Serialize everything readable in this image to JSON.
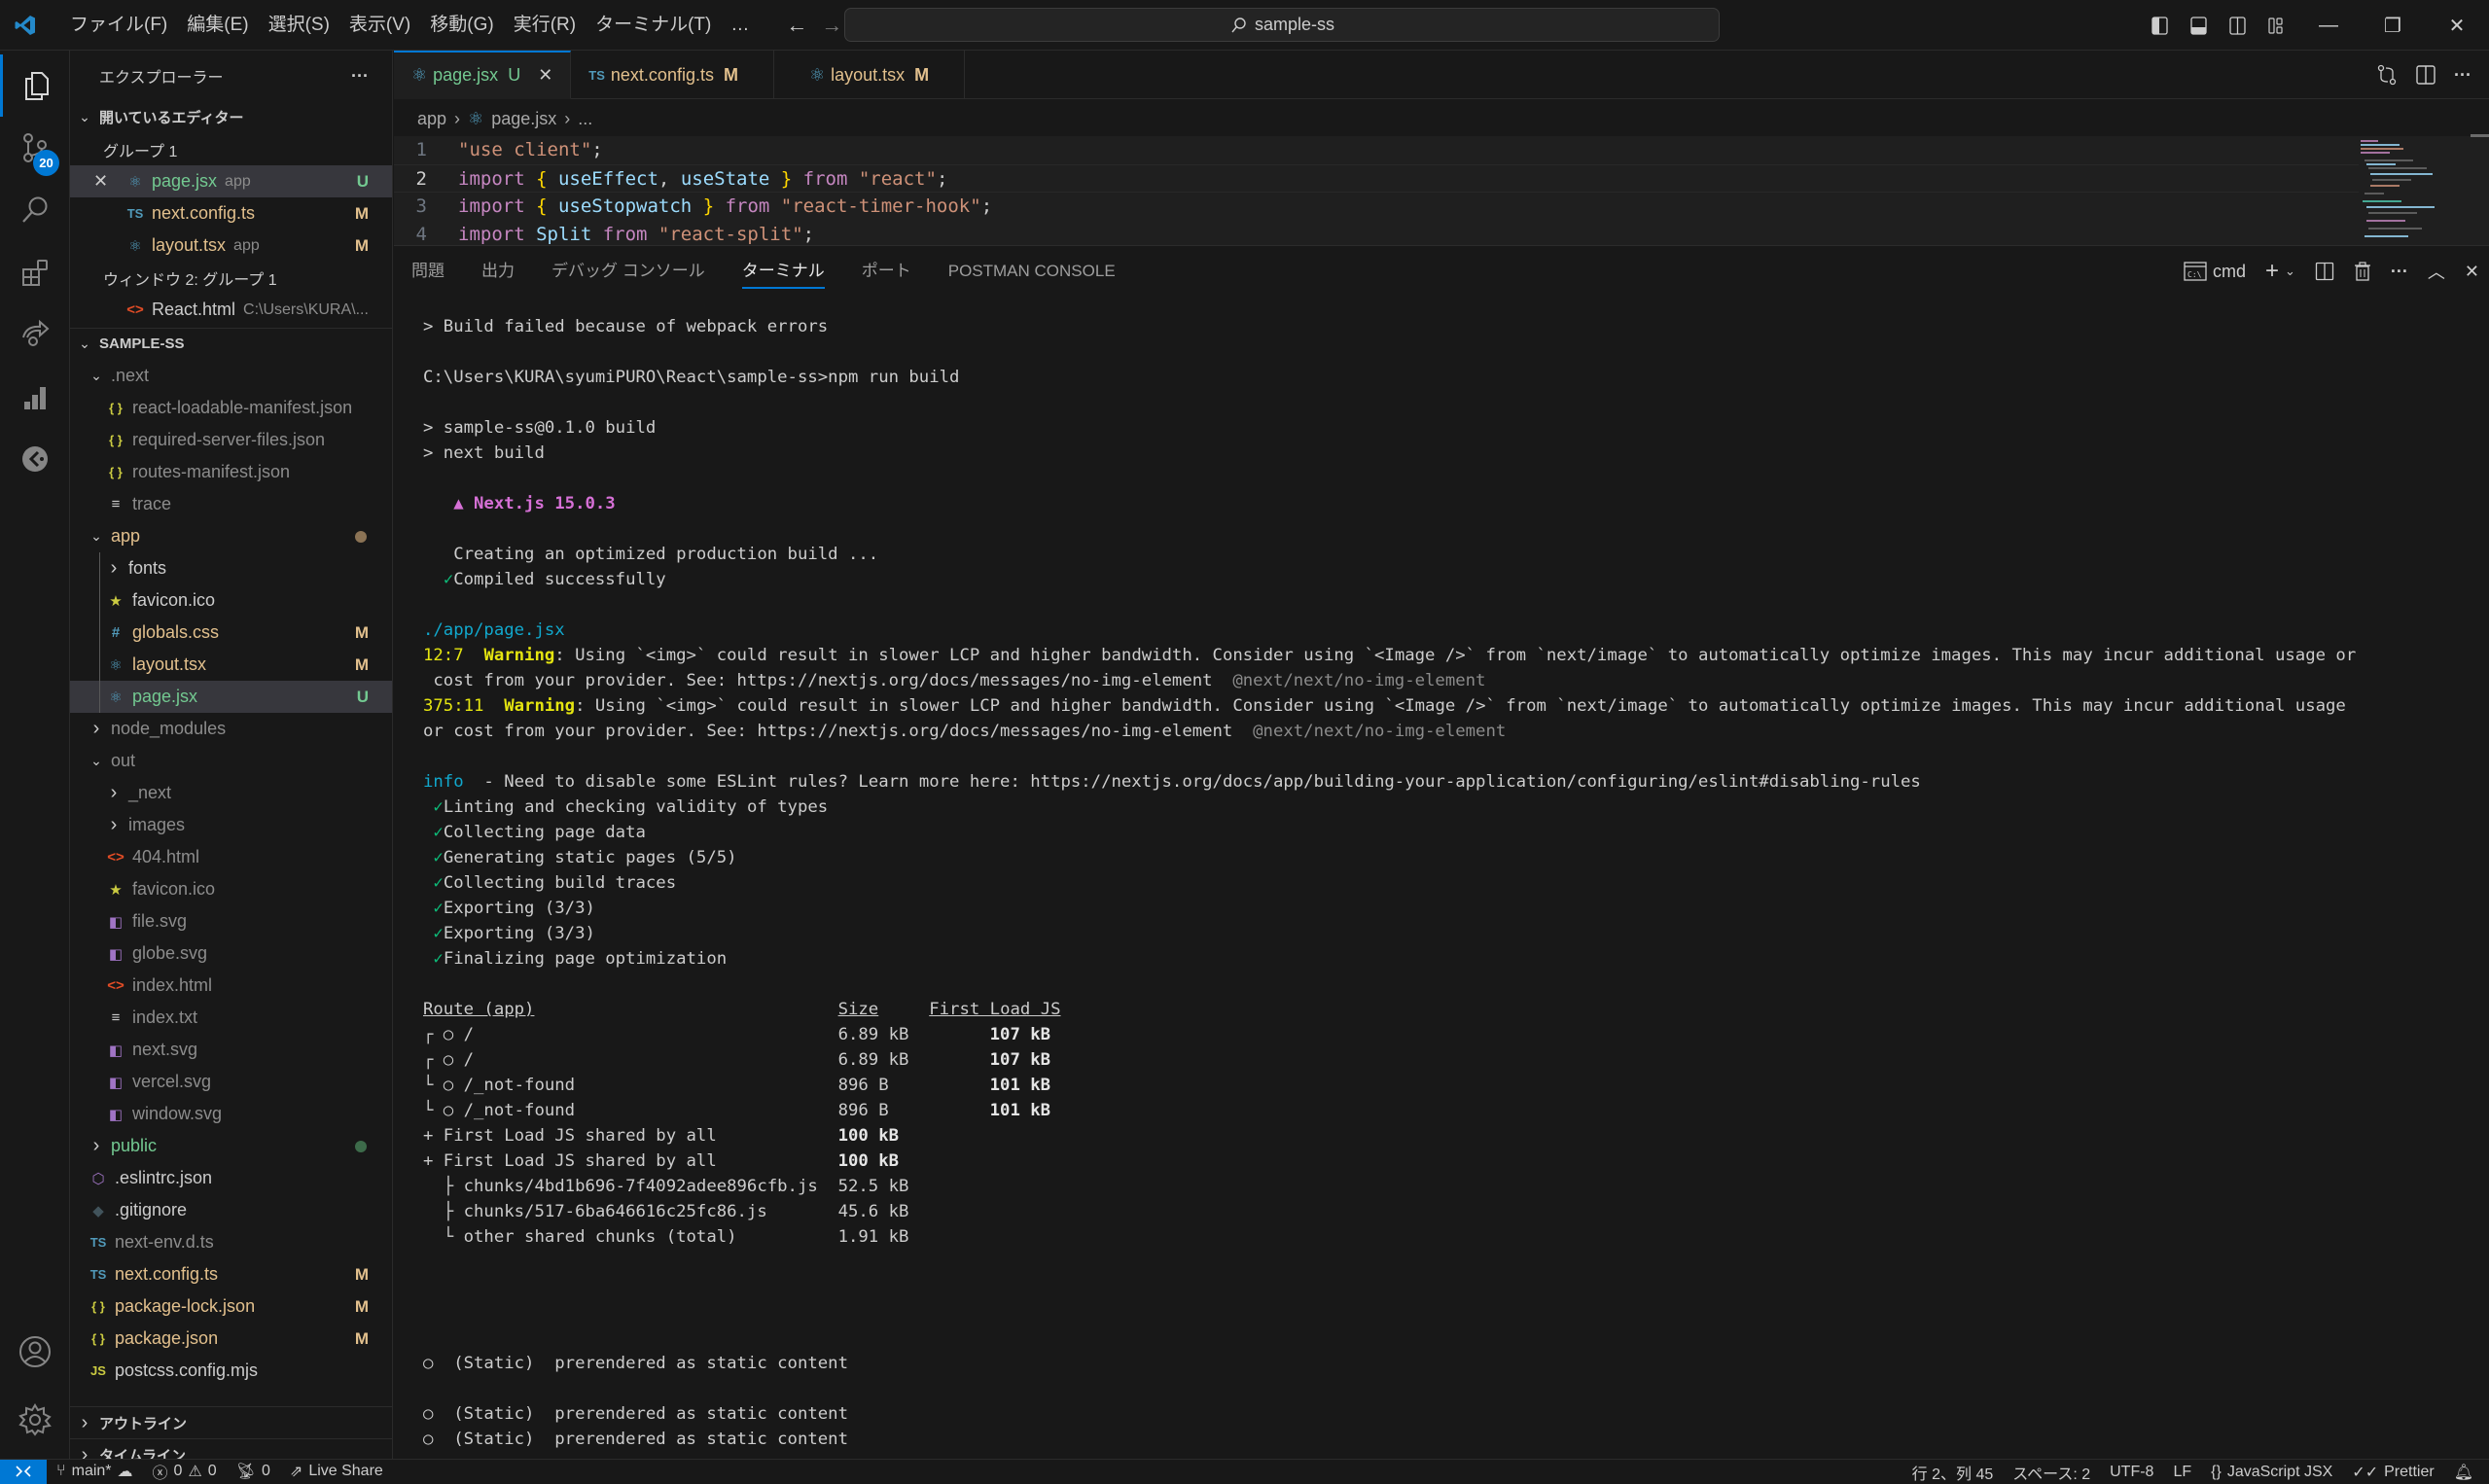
{
  "titlebar": {
    "menu": [
      "ファイル(F)",
      "編集(E)",
      "選択(S)",
      "表示(V)",
      "移動(G)",
      "実行(R)",
      "ターミナル(T)",
      "…"
    ],
    "search_text": "sample-ss",
    "icons": [
      "vscode-logo-icon",
      "back-arrow-icon",
      "forward-arrow-icon",
      "toggle-primary-sidebar-icon",
      "toggle-panel-icon",
      "toggle-secondary-sidebar-icon",
      "customize-layout-icon",
      "minimize-icon",
      "restore-icon",
      "close-icon"
    ]
  },
  "activitybar": {
    "items": [
      {
        "name": "explorer",
        "active": true
      },
      {
        "name": "source-control",
        "badge": "20"
      },
      {
        "name": "search"
      },
      {
        "name": "extensions"
      },
      {
        "name": "live-share"
      },
      {
        "name": "charts"
      },
      {
        "name": "gitlens"
      }
    ],
    "bottom": [
      "accounts",
      "manage"
    ]
  },
  "sidebar": {
    "title": "エクスプローラー",
    "more": "···",
    "open_editors": {
      "header": "開いているエディター",
      "group1": "グループ 1",
      "files": [
        {
          "name": "page.jsx",
          "desc": "app",
          "deco": "U",
          "icon": "react",
          "state": "untracked",
          "selected": true
        },
        {
          "name": "next.config.ts",
          "desc": "",
          "deco": "M",
          "icon": "ts",
          "state": "modified"
        },
        {
          "name": "layout.tsx",
          "desc": "app",
          "deco": "M",
          "icon": "react",
          "state": "modified"
        }
      ],
      "group2": "ウィンドウ 2: グループ 1",
      "files2": [
        {
          "name": "React.html",
          "desc": "C:\\Users\\KURA\\...",
          "icon": "html"
        }
      ]
    },
    "project": {
      "header": "SAMPLE-SS",
      "tree": [
        {
          "name": ".next",
          "type": "folder",
          "open": true,
          "depth": 1,
          "state": "ignored"
        },
        {
          "name": "react-loadable-manifest.json",
          "type": "json",
          "depth": 2,
          "state": "ignored"
        },
        {
          "name": "required-server-files.json",
          "type": "json",
          "depth": 2,
          "state": "ignored"
        },
        {
          "name": "routes-manifest.json",
          "type": "json",
          "depth": 2,
          "state": "ignored"
        },
        {
          "name": "trace",
          "type": "text",
          "depth": 2,
          "state": "ignored"
        },
        {
          "name": "app",
          "type": "folder",
          "open": true,
          "depth": 1,
          "state": "modified",
          "dot": "#8b7355"
        },
        {
          "name": "fonts",
          "type": "folder",
          "open": false,
          "depth": 2,
          "state": "normal"
        },
        {
          "name": "favicon.ico",
          "type": "star",
          "depth": 2,
          "state": "normal"
        },
        {
          "name": "globals.css",
          "type": "css",
          "depth": 2,
          "state": "modified",
          "deco": "M"
        },
        {
          "name": "layout.tsx",
          "type": "react",
          "depth": 2,
          "state": "modified",
          "deco": "M"
        },
        {
          "name": "page.jsx",
          "type": "react",
          "depth": 2,
          "state": "untracked",
          "deco": "U",
          "selected": true
        },
        {
          "name": "node_modules",
          "type": "folder",
          "open": false,
          "depth": 1,
          "state": "ignored"
        },
        {
          "name": "out",
          "type": "folder",
          "open": true,
          "depth": 1,
          "state": "ignored"
        },
        {
          "name": "_next",
          "type": "folder",
          "open": false,
          "depth": 2,
          "state": "ignored"
        },
        {
          "name": "images",
          "type": "folder",
          "open": false,
          "depth": 2,
          "state": "ignored"
        },
        {
          "name": "404.html",
          "type": "html",
          "depth": 2,
          "state": "ignored"
        },
        {
          "name": "favicon.ico",
          "type": "star",
          "depth": 2,
          "state": "ignored"
        },
        {
          "name": "file.svg",
          "type": "svg",
          "depth": 2,
          "state": "ignored"
        },
        {
          "name": "globe.svg",
          "type": "svg",
          "depth": 2,
          "state": "ignored"
        },
        {
          "name": "index.html",
          "type": "html",
          "depth": 2,
          "state": "ignored"
        },
        {
          "name": "index.txt",
          "type": "text",
          "depth": 2,
          "state": "ignored"
        },
        {
          "name": "next.svg",
          "type": "svg",
          "depth": 2,
          "state": "ignored"
        },
        {
          "name": "vercel.svg",
          "type": "svg",
          "depth": 2,
          "state": "ignored"
        },
        {
          "name": "window.svg",
          "type": "svg",
          "depth": 2,
          "state": "ignored"
        },
        {
          "name": "public",
          "type": "folder",
          "open": false,
          "depth": 1,
          "state": "untracked",
          "dot": "#3d6b4a"
        },
        {
          "name": ".eslintrc.json",
          "type": "eslint",
          "depth": 1,
          "state": "normal"
        },
        {
          "name": ".gitignore",
          "type": "git",
          "depth": 1,
          "state": "normal"
        },
        {
          "name": "next-env.d.ts",
          "type": "ts",
          "depth": 1,
          "state": "ignored"
        },
        {
          "name": "next.config.ts",
          "type": "ts",
          "depth": 1,
          "state": "modified",
          "deco": "M"
        },
        {
          "name": "package-lock.json",
          "type": "json",
          "depth": 1,
          "state": "modified",
          "deco": "M"
        },
        {
          "name": "package.json",
          "type": "json",
          "depth": 1,
          "state": "modified",
          "deco": "M"
        },
        {
          "name": "postcss.config.mjs",
          "type": "js",
          "depth": 1,
          "state": "normal"
        }
      ]
    },
    "outline": "アウトライン",
    "timeline": "タイムライン"
  },
  "editor": {
    "tabs": [
      {
        "label": "page.jsx",
        "badge": "U",
        "icon": "react",
        "active": true
      },
      {
        "label": "next.config.ts",
        "badge": "M",
        "icon": "ts"
      },
      {
        "label": "layout.tsx",
        "badge": "M",
        "icon": "react"
      }
    ],
    "breadcrumb": [
      "app",
      "page.jsx",
      "..."
    ],
    "current_line": 2,
    "lines": [
      {
        "n": "1",
        "tokens": [
          {
            "t": "\"use client\"",
            "c": "str"
          },
          {
            "t": ";",
            "c": "pl"
          }
        ]
      },
      {
        "n": "2",
        "tokens": [
          {
            "t": "import ",
            "c": "kw"
          },
          {
            "t": "{ ",
            "c": "br"
          },
          {
            "t": "useEffect",
            "c": "var"
          },
          {
            "t": ", ",
            "c": "pl"
          },
          {
            "t": "useState",
            "c": "var"
          },
          {
            "t": " }",
            "c": "br"
          },
          {
            "t": " from ",
            "c": "kw"
          },
          {
            "t": "\"react\"",
            "c": "str"
          },
          {
            "t": ";",
            "c": "pl"
          }
        ]
      },
      {
        "n": "3",
        "tokens": [
          {
            "t": "import ",
            "c": "kw"
          },
          {
            "t": "{ ",
            "c": "br"
          },
          {
            "t": "useStopwatch",
            "c": "var"
          },
          {
            "t": " }",
            "c": "br"
          },
          {
            "t": " from ",
            "c": "kw"
          },
          {
            "t": "\"react-timer-hook\"",
            "c": "str"
          },
          {
            "t": ";",
            "c": "pl"
          }
        ]
      },
      {
        "n": "4",
        "tokens": [
          {
            "t": "import ",
            "c": "kw"
          },
          {
            "t": "Split",
            "c": "var"
          },
          {
            "t": " from ",
            "c": "kw"
          },
          {
            "t": "\"react-split\"",
            "c": "str"
          },
          {
            "t": ";",
            "c": "pl"
          }
        ]
      }
    ]
  },
  "panel": {
    "tabs": [
      "問題",
      "出力",
      "デバッグ コンソール",
      "ターミナル",
      "ポート",
      "POSTMAN CONSOLE"
    ],
    "active_tab": "ターミナル",
    "terminal_name": "cmd",
    "terminal_lines": [
      [
        {
          "t": "> Build failed because of webpack errors"
        }
      ],
      [],
      [
        {
          "t": "C:\\Users\\KURA\\syumiPURO\\React\\sample-ss>npm run build"
        }
      ],
      [],
      [
        {
          "t": "> sample-ss@0.1.0 build"
        }
      ],
      [
        {
          "t": "> next build"
        }
      ],
      [],
      [
        {
          "t": "   "
        },
        {
          "t": "▲ Next.js 15.0.3",
          "c": "t-pink"
        }
      ],
      [],
      [
        {
          "t": "   Creating an optimized production build ..."
        }
      ],
      [
        {
          "t": "  "
        },
        {
          "t": "✓",
          "c": "t-check"
        },
        {
          "t": "Compiled successfully"
        }
      ],
      [],
      [
        {
          "t": "./app/page.jsx",
          "c": "t-cyan"
        }
      ],
      [
        {
          "t": "12:7",
          "c": "t-yellow"
        },
        {
          "t": "  "
        },
        {
          "t": "Warning",
          "c": "t-ybold"
        },
        {
          "t": ": Using `<img>` could result in slower LCP and higher bandwidth. Consider using `<Image />` from `next/image` to automatically optimize images. This may incur additional usage or"
        }
      ],
      [
        {
          "t": " cost from your provider. See: https://nextjs.org/docs/messages/no-img-element  "
        },
        {
          "t": "@next/next/no-img-element",
          "c": "t-gray"
        }
      ],
      [
        {
          "t": "375:11",
          "c": "t-yellow"
        },
        {
          "t": "  "
        },
        {
          "t": "Warning",
          "c": "t-ybold"
        },
        {
          "t": ": Using `<img>` could result in slower LCP and higher bandwidth. Consider using `<Image />` from `next/image` to automatically optimize images. This may incur additional usage"
        }
      ],
      [
        {
          "t": "or cost from your provider. See: https://nextjs.org/docs/messages/no-img-element  "
        },
        {
          "t": "@next/next/no-img-element",
          "c": "t-gray"
        }
      ],
      [],
      [
        {
          "t": "info",
          "c": "t-cyan"
        },
        {
          "t": "  - Need to disable some ESLint rules? Learn more here: https://nextjs.org/docs/app/building-your-application/configuring/eslint#disabling-rules"
        }
      ],
      [
        {
          "t": " "
        },
        {
          "t": "✓",
          "c": "t-check"
        },
        {
          "t": "Linting and checking validity of types"
        }
      ],
      [
        {
          "t": " "
        },
        {
          "t": "✓",
          "c": "t-check"
        },
        {
          "t": "Collecting page data"
        }
      ],
      [
        {
          "t": " "
        },
        {
          "t": "✓",
          "c": "t-check"
        },
        {
          "t": "Generating static pages (5/5)"
        }
      ],
      [
        {
          "t": " "
        },
        {
          "t": "✓",
          "c": "t-check"
        },
        {
          "t": "Collecting build traces"
        }
      ],
      [
        {
          "t": " "
        },
        {
          "t": "✓",
          "c": "t-check"
        },
        {
          "t": "Exporting (3/3)"
        }
      ],
      [
        {
          "t": " "
        },
        {
          "t": "✓",
          "c": "t-check"
        },
        {
          "t": "Exporting (3/3)"
        }
      ],
      [
        {
          "t": " "
        },
        {
          "t": "✓",
          "c": "t-check"
        },
        {
          "t": "Finalizing page optimization"
        }
      ],
      [],
      [
        {
          "t": "Route (app)",
          "c": "t-u"
        },
        {
          "t": "                              "
        },
        {
          "t": "Size",
          "c": "t-u"
        },
        {
          "t": "     "
        },
        {
          "t": "First Load JS",
          "c": "t-u"
        }
      ],
      [
        {
          "t": "┌ ○ /                                    6.89 kB        "
        },
        {
          "t": "107 kB",
          "c": "t-bold"
        }
      ],
      [
        {
          "t": "┌ ○ /                                    6.89 kB        "
        },
        {
          "t": "107 kB",
          "c": "t-bold"
        }
      ],
      [
        {
          "t": "└ ○ /_not-found                          896 B          "
        },
        {
          "t": "101 kB",
          "c": "t-bold"
        }
      ],
      [
        {
          "t": "└ ○ /_not-found                          896 B          "
        },
        {
          "t": "101 kB",
          "c": "t-bold"
        }
      ],
      [
        {
          "t": "+ First Load JS shared by all            "
        },
        {
          "t": "100 kB",
          "c": "t-bold"
        }
      ],
      [
        {
          "t": "+ First Load JS shared by all            "
        },
        {
          "t": "100 kB",
          "c": "t-bold"
        }
      ],
      [
        {
          "t": "  ├ chunks/4bd1b696-7f4092adee896cfb.js  52.5 kB"
        }
      ],
      [
        {
          "t": "  ├ chunks/517-6ba646616c25fc86.js       45.6 kB"
        }
      ],
      [
        {
          "t": "  └ other shared chunks (total)          1.91 kB"
        }
      ],
      [],
      [],
      [],
      [],
      [
        {
          "t": "○  (Static)  prerendered as static content"
        }
      ],
      [],
      [
        {
          "t": "○  (Static)  prerendered as static content"
        }
      ],
      [
        {
          "t": "○  (Static)  prerendered as static content"
        }
      ]
    ]
  },
  "statusbar": {
    "branch": "main*",
    "errors": "0",
    "warnings": "0",
    "ports": "0",
    "live_share": "Live Share",
    "position": "行 2、列 45",
    "spaces": "スペース: 2",
    "encoding": "UTF-8",
    "eol": "LF",
    "language": "JavaScript JSX",
    "formatter": "Prettier"
  },
  "colors": {
    "accent": "#0078d4",
    "untracked": "#73c991",
    "modified": "#e2c08d",
    "background": "#181818",
    "editor_background": "#1f1f1f"
  }
}
